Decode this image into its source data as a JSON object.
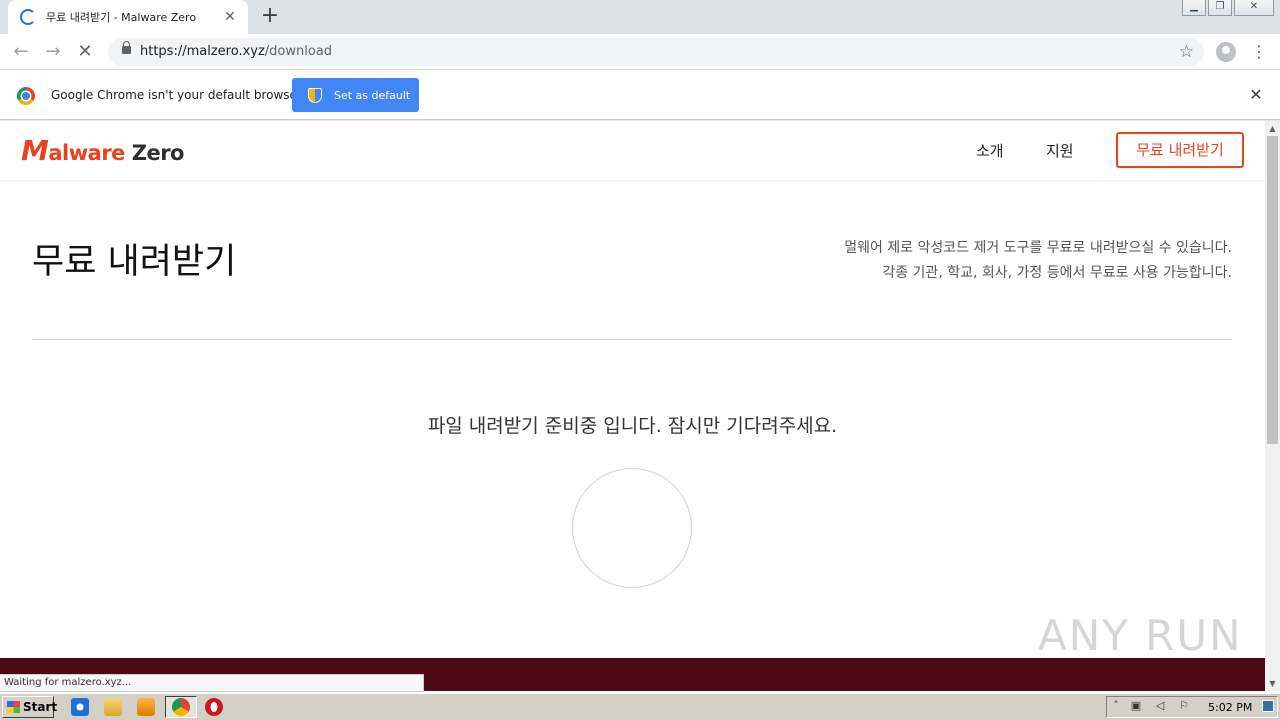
{
  "browser": {
    "tab_title": "무료 내려받기 - Malware Zero",
    "new_tab_symbol": "+",
    "tab_close_symbol": "✕",
    "url_host": "https://malzero.xyz",
    "url_path": "/download",
    "infobar": {
      "message": "Google Chrome isn't your default browser",
      "button_label": "Set as default",
      "close_symbol": "✕"
    },
    "status_text": "Waiting for malzero.xyz..."
  },
  "site": {
    "logo_m": "M",
    "logo_rest": "alware",
    "logo_zero": " Zero",
    "nav": [
      "소개",
      "지원"
    ],
    "cta_label": "무료 내려받기",
    "page_title": "무료 내려받기",
    "description_lines": [
      "멀웨어 제로 악성코드 제거 도구를 무료로 내려받으실 수 있습니다.",
      "각종 기관, 학교, 회사, 가정 등에서 무료로 사용 가능합니다."
    ],
    "wait_message": "파일 내려받기 준비중 입니다. 잠시만 기다려주세요.",
    "brand_color": "#e8421f",
    "footer_color": "#4c0915"
  },
  "watermark": "ANY RUN",
  "taskbar": {
    "start_label": "Start",
    "clock": "5:02 PM",
    "icons": [
      "ie-icon",
      "explorer-icon",
      "media-player-icon",
      "chrome-icon",
      "opera-icon"
    ]
  }
}
